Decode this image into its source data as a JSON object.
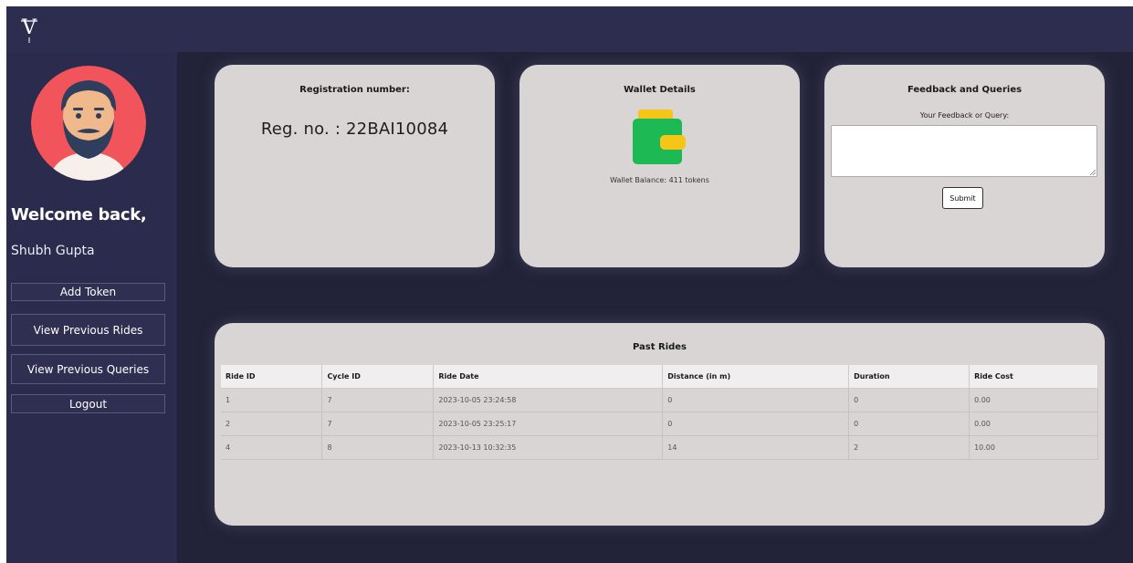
{
  "brand": {
    "logo_letter": "V"
  },
  "sidebar": {
    "welcome": "Welcome back,",
    "username": "Shubh Gupta",
    "buttons": {
      "add_token": "Add Token",
      "view_rides": "View Previous Rides",
      "view_queries": "View Previous Queries",
      "logout": "Logout"
    }
  },
  "registration": {
    "title": "Registration number:",
    "value": "Reg. no. : 22BAI10084"
  },
  "wallet": {
    "title": "Wallet Details",
    "icon": "wallet-icon",
    "balance_text": "Wallet Balance: 411 tokens"
  },
  "feedback": {
    "title": "Feedback and Queries",
    "label": "Your Feedback or Query:",
    "value": "",
    "submit": "Submit"
  },
  "rides": {
    "title": "Past Rides",
    "columns": [
      "Ride ID",
      "Cycle ID",
      "Ride Date",
      "Distance (in m)",
      "Duration",
      "Ride Cost"
    ],
    "rows": [
      [
        "1",
        "7",
        "2023-10-05 23:24:58",
        "0",
        "0",
        "0.00"
      ],
      [
        "2",
        "7",
        "2023-10-05 23:25:17",
        "0",
        "0",
        "0.00"
      ],
      [
        "4",
        "8",
        "2023-10-13 10:32:35",
        "14",
        "2",
        "10.00"
      ]
    ]
  },
  "colors": {
    "sidebar": "#2b2b4e",
    "main_bg": "#222238",
    "card": "#d8d5d4",
    "avatar_bg": "#f2545b",
    "wallet_green": "#1db954",
    "wallet_yellow": "#f5c518"
  }
}
